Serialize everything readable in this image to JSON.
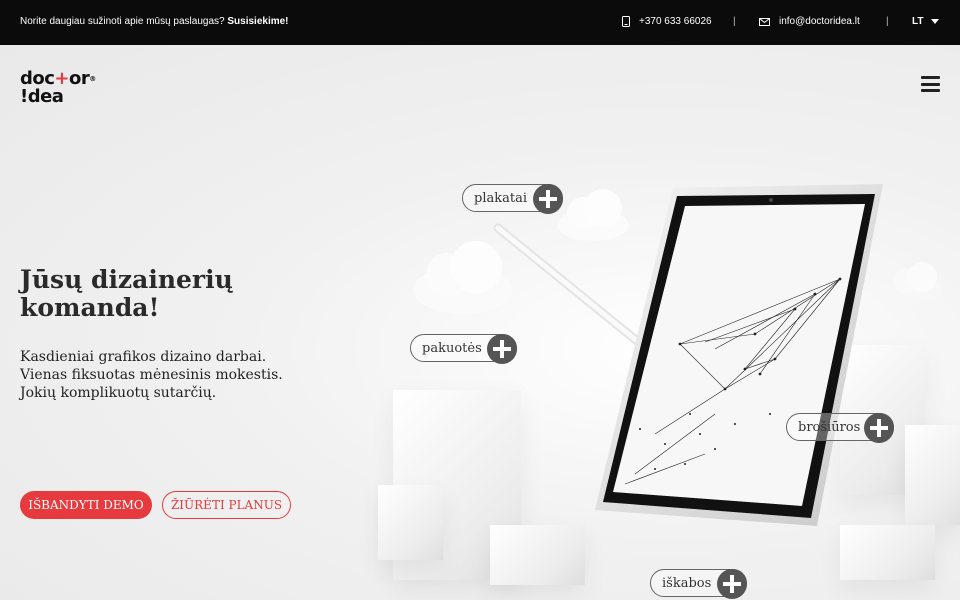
{
  "topbar": {
    "promo_text": "Norite daugiau sužinoti apie mūsų paslaugas? ",
    "promo_link": "Susisiekime!",
    "phone": "+370 633 66026",
    "separator": "|",
    "email": "info@doctoridea.lt",
    "language": "LT"
  },
  "logo": {
    "line1_a": "doc",
    "line1_plus": "+",
    "line1_b": "or",
    "line2": "!dea",
    "registered": "®"
  },
  "hero": {
    "headline": "Jūsų dizainerių komanda!",
    "sub_lines": [
      "Kasdieniai grafikos dizaino darbai.",
      "Vienas fiksuotas mėnesinis mokestis.",
      "Jokių komplikuotų sutarčių."
    ],
    "btn_demo": "IŠBANDYTI DEMO",
    "btn_plans": "ŽIŪRĖTI PLANUS"
  },
  "tags": {
    "plakatai": "plakatai",
    "pakuotes": "pakuotės",
    "brosiuros": "brošiūros",
    "iskabos": "iškabos"
  },
  "colors": {
    "accent": "#e63a3f",
    "topbar_bg": "#0b0b0b"
  }
}
